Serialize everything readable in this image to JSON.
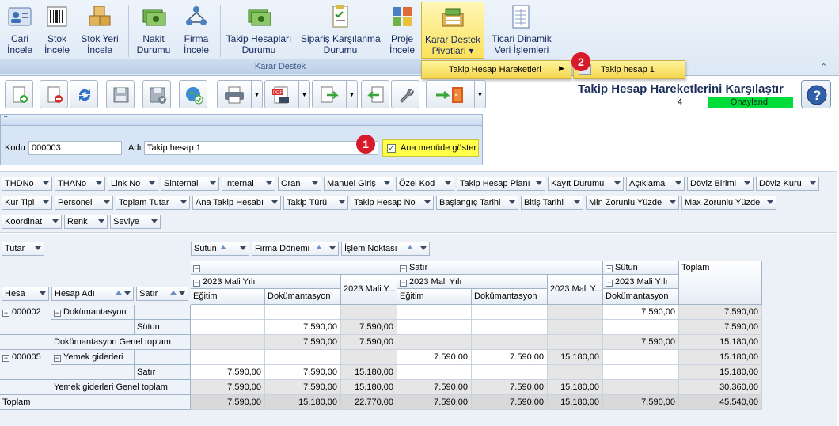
{
  "ribbon": {
    "buttons": [
      {
        "line1": "Cari",
        "line2": "İncele"
      },
      {
        "line1": "Stok",
        "line2": "İncele"
      },
      {
        "line1": "Stok Yeri",
        "line2": "İncele"
      },
      {
        "line1": "Nakit",
        "line2": "Durumu"
      },
      {
        "line1": "Firma",
        "line2": "İncele"
      },
      {
        "line1": "Takip Hesapları",
        "line2": "Durumu"
      },
      {
        "line1": "Sipariş Karşılanma",
        "line2": "Durumu"
      },
      {
        "line1": "Proje",
        "line2": "İncele"
      },
      {
        "line1": "Karar Destek",
        "line2": "Pivotları ▾"
      },
      {
        "line1": "Ticari Dinamik",
        "line2": "Veri İşlemleri"
      }
    ],
    "group_label": "Karar Destek",
    "collapse_glyph": "⌃"
  },
  "menu": {
    "item1": "Takip Hesap Hareketleri",
    "item2": "Takip hesap 1",
    "marker1": "1",
    "marker2": "2"
  },
  "header": {
    "title": "Takip Hesap Hareketlerini Karşılaştır",
    "record_no": "4",
    "status": "Onaylandı",
    "help": "?"
  },
  "form": {
    "collapse_glyph": "⌃",
    "code_label": "Kodu",
    "code_value": "000003",
    "name_label": "Adı",
    "name_value": "Takip hesap 1",
    "show_in_menu_label": "Ana menüde göster",
    "show_in_menu_checked": "✓"
  },
  "filter_fields": {
    "row1": [
      "THDNo",
      "THANo",
      "Link No",
      "Sinternal",
      "İnternal",
      "Oran",
      "Manuel Giriş",
      "Özel Kod",
      "Takip Hesap Planı",
      "Kayıt Durumu",
      "Açıklama",
      "Döviz Birimi",
      "Döviz Kuru"
    ],
    "row2": [
      "Kur Tipi",
      "Personel",
      "Toplam Tutar",
      "Ana Takip Hesabı",
      "Takip Türü",
      "Takip Hesap No",
      "Başlangıç Tarihi",
      "Bitiş Tarihi",
      "Min Zorunlu Yüzde",
      "Max Zorunlu Yüzde"
    ],
    "row3": [
      "Koordinat",
      "Renk",
      "Seviye"
    ]
  },
  "pivot": {
    "data_field": "Tutar",
    "column_fields": [
      "Sutun",
      "Firma Dönemi",
      "İşlem Noktası"
    ],
    "row_fields": [
      "Hesa",
      "Hesap Adı",
      "Satır"
    ],
    "col_headers": {
      "g1": "",
      "g2": "Satır",
      "g3": "Sütun",
      "total": "Toplam",
      "year": "2023 Mali Yılı",
      "year_total": "2023 Mali Y...",
      "c1": "Eğitim",
      "c2": "Dokümantasyon"
    },
    "rows": {
      "r1_code": "000002",
      "r1_name": "Dokümantasyon",
      "r1_sub": "Sütun",
      "r1_total": "Dokümantasyon Genel toplam",
      "r2_code": "000005",
      "r2_name": "Yemek giderleri",
      "r2_sub": "Satır",
      "r2_total": "Yemek giderleri Genel toplam",
      "grand": "Toplam"
    },
    "values": {
      "r1a": [
        "",
        "",
        "",
        "",
        "",
        "",
        "7.590,00",
        "7.590,00"
      ],
      "r1b": [
        "",
        "7.590,00",
        "7.590,00",
        "",
        "",
        "",
        "",
        "7.590,00"
      ],
      "r1t": [
        "",
        "7.590,00",
        "7.590,00",
        "",
        "",
        "",
        "7.590,00",
        "15.180,00"
      ],
      "r2a": [
        "",
        "",
        "",
        "7.590,00",
        "7.590,00",
        "15.180,00",
        "",
        "15.180,00"
      ],
      "r2b": [
        "7.590,00",
        "7.590,00",
        "15.180,00",
        "",
        "",
        "",
        "",
        "15.180,00"
      ],
      "r2t": [
        "7.590,00",
        "7.590,00",
        "15.180,00",
        "7.590,00",
        "7.590,00",
        "15.180,00",
        "",
        "30.360,00"
      ],
      "gt": [
        "7.590,00",
        "15.180,00",
        "22.770,00",
        "7.590,00",
        "7.590,00",
        "15.180,00",
        "7.590,00",
        "45.540,00"
      ]
    }
  }
}
